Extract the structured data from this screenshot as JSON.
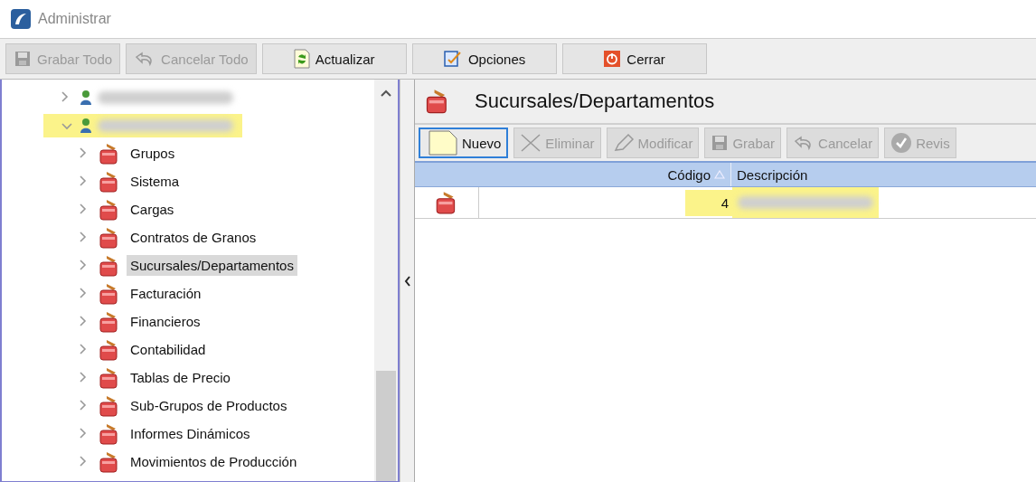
{
  "window": {
    "title": "Administrar"
  },
  "toolbar": [
    {
      "label": "Grabar Todo",
      "kind": "save",
      "disabled": true
    },
    {
      "label": "Cancelar Todo",
      "kind": "undo",
      "disabled": true
    },
    {
      "label": "Actualizar",
      "kind": "refresh",
      "disabled": false
    },
    {
      "label": "Opciones",
      "kind": "options",
      "disabled": false
    },
    {
      "label": "Cerrar",
      "kind": "close",
      "disabled": false
    }
  ],
  "tree": {
    "items": [
      {
        "kind": "user",
        "highlighted": false,
        "expanded": false
      },
      {
        "kind": "user",
        "highlighted": true,
        "expanded": true,
        "children": [
          {
            "label": "Grupos",
            "selected": false
          },
          {
            "label": "Sistema",
            "selected": false
          },
          {
            "label": "Cargas",
            "selected": false
          },
          {
            "label": "Contratos de Granos",
            "selected": false
          },
          {
            "label": "Sucursales/Departamentos",
            "selected": true
          },
          {
            "label": "Facturación",
            "selected": false
          },
          {
            "label": "Financieros",
            "selected": false
          },
          {
            "label": "Contabilidad",
            "selected": false
          },
          {
            "label": "Tablas de Precio",
            "selected": false
          },
          {
            "label": "Sub-Grupos de Productos",
            "selected": false
          },
          {
            "label": "Informes Dinámicos",
            "selected": false
          },
          {
            "label": "Movimientos de Producción",
            "selected": false
          }
        ]
      }
    ]
  },
  "panel": {
    "title": "Sucursales/Departamentos",
    "toolbar": [
      {
        "label": "Nuevo",
        "kind": "new",
        "disabled": false,
        "focused": true
      },
      {
        "label": "Eliminar",
        "kind": "delete",
        "disabled": true,
        "focused": false
      },
      {
        "label": "Modificar",
        "kind": "edit",
        "disabled": true,
        "focused": false
      },
      {
        "label": "Grabar",
        "kind": "save",
        "disabled": true,
        "focused": false
      },
      {
        "label": "Cancelar",
        "kind": "undo",
        "disabled": true,
        "focused": false
      },
      {
        "label": "Revis",
        "kind": "check",
        "disabled": true,
        "focused": false
      }
    ],
    "table": {
      "columns": [
        {
          "label": "Código",
          "sorted": true
        },
        {
          "label": "Descripción",
          "sorted": false
        }
      ],
      "rows": [
        {
          "codigo": "4",
          "highlighted": true
        }
      ]
    }
  }
}
